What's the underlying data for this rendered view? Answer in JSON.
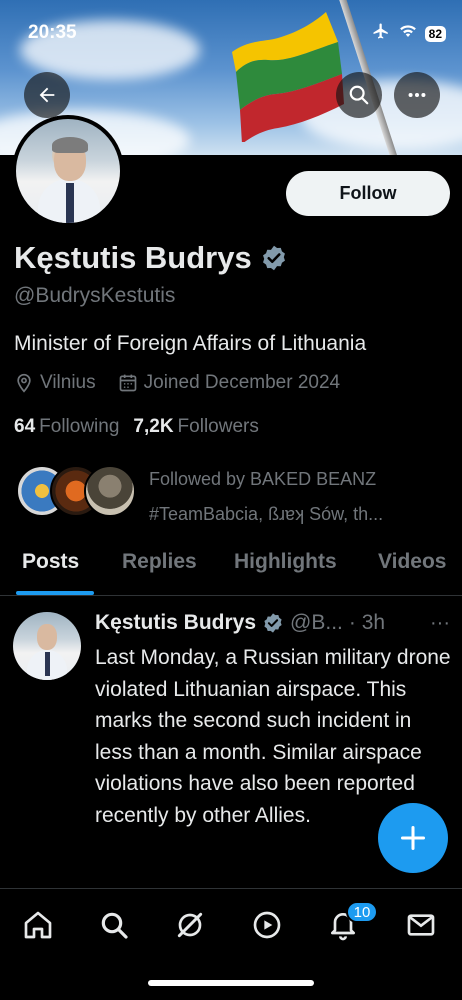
{
  "status_bar": {
    "time": "20:35",
    "battery": "82"
  },
  "profile": {
    "name": "Kęstutis Budrys",
    "handle": "@BudrysKestutis",
    "bio": "Minister of Foreign Affairs of Lithuania",
    "location": "Vilnius",
    "joined": "Joined December 2024",
    "following_count": "64",
    "following_label": "Following",
    "followers_count": "7,2K",
    "followers_label": "Followers",
    "follow_button": "Follow",
    "followed_by_line1": "Followed by BAKED BEANZ",
    "followed_by_line2": "#TeamBabcia, ßɹɐʞ Sów, th..."
  },
  "tabs": [
    "Posts",
    "Replies",
    "Highlights",
    "Videos"
  ],
  "post": {
    "author": "Kęstutis Budrys",
    "handle": "@B...",
    "time": "· 3h",
    "more": "···",
    "text": "Last Monday, a Russian military drone violated Lithuanian airspace. This marks the second such incident in less than a month. Similar airspace violations have also been reported recently by other Allies."
  },
  "bottom_nav": {
    "items": [
      "home-icon",
      "search-icon",
      "grok-icon",
      "video-icon",
      "notifications-icon",
      "messages-icon"
    ],
    "notification_count": "10"
  },
  "colors": {
    "accent": "#1d9bf0",
    "background": "#000000",
    "secondary_text": "#71767b"
  }
}
